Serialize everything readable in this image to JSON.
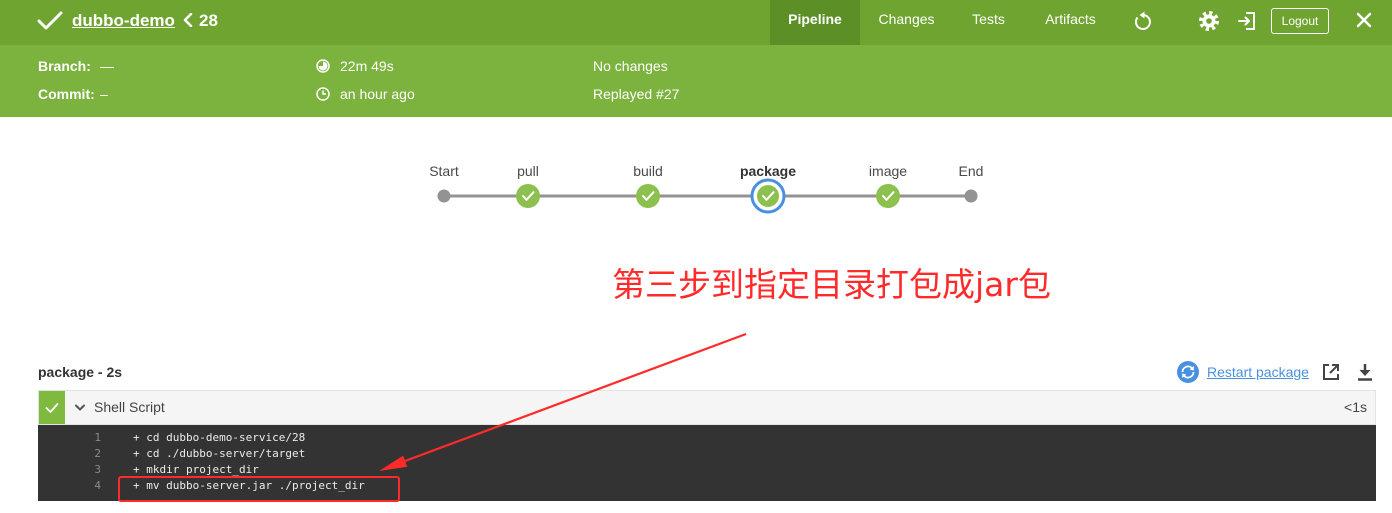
{
  "header": {
    "status_icon": "check-icon",
    "pipeline_name": "dubbo-demo",
    "separator_icon": "chevron-left-icon",
    "run_number": "28",
    "tabs": [
      {
        "label": "Pipeline",
        "active": true
      },
      {
        "label": "Changes",
        "active": false
      },
      {
        "label": "Tests",
        "active": false
      },
      {
        "label": "Artifacts",
        "active": false
      }
    ],
    "actions": {
      "replay_icon": "replay-icon",
      "settings_icon": "gear-icon",
      "exit_icon": "exit-icon",
      "logout_label": "Logout",
      "close_icon": "close-icon"
    }
  },
  "summary": {
    "branch_label": "Branch:",
    "branch_value": "—",
    "commit_label": "Commit:",
    "commit_value": "–",
    "duration_icon": "pie-timer-icon",
    "duration": "22m 49s",
    "started_icon": "clock-icon",
    "started": "an hour ago",
    "changes": "No changes",
    "replayed": "Replayed #27"
  },
  "graph": {
    "stages": [
      {
        "label": "Start",
        "passed": false,
        "selected": false
      },
      {
        "label": "pull",
        "passed": true,
        "selected": false
      },
      {
        "label": "build",
        "passed": true,
        "selected": false
      },
      {
        "label": "package",
        "passed": true,
        "selected": true
      },
      {
        "label": "image",
        "passed": true,
        "selected": false
      },
      {
        "label": "End",
        "passed": false,
        "selected": false
      }
    ]
  },
  "annotation": {
    "text": "第三步到指定目录打包成jar包",
    "color": "#ff2a2a"
  },
  "stage_detail": {
    "title": "package - 2s",
    "restart_icon": "restart-icon",
    "restart_label": "Restart package",
    "open_icon": "external-link-icon",
    "download_icon": "download-icon"
  },
  "step": {
    "passed": true,
    "status_icon": "check-icon",
    "expand_icon": "chevron-down-icon",
    "name": "Shell Script",
    "duration": "<1s"
  },
  "log": {
    "lines": [
      {
        "number": "1",
        "text": "+ cd dubbo-demo-service/28"
      },
      {
        "number": "2",
        "text": "+ cd ./dubbo-server/target"
      },
      {
        "number": "3",
        "text": "+ mkdir project_dir"
      },
      {
        "number": "4",
        "text": "+ mv dubbo-server.jar ./project_dir"
      }
    ],
    "highlighted_line": 4
  },
  "colors": {
    "header": "#6fa430",
    "band": "#7bb33e",
    "active": "#5d8f27",
    "success": "#8cc04f",
    "ring": "#4a90e2",
    "link": "#4a90e2",
    "annot": "#ff2a2a",
    "logbg": "#333333"
  }
}
